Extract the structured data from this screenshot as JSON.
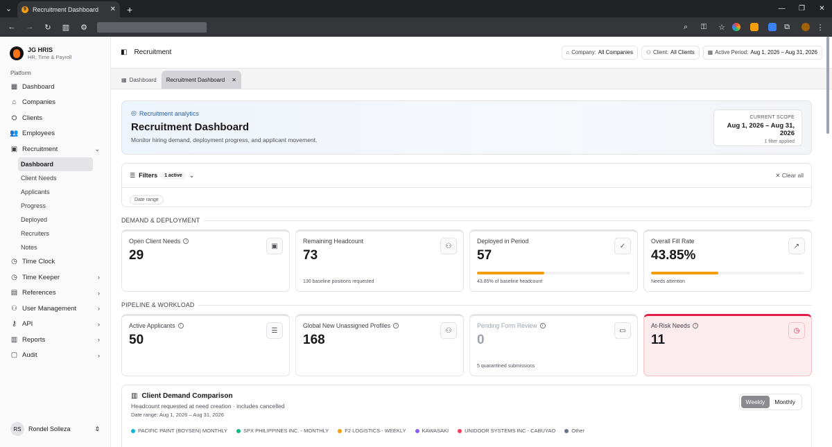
{
  "browser": {
    "tab_title": "Recruitment Dashboard"
  },
  "brand": {
    "name": "JG HRIS",
    "subtitle": "HR, Time & Payroll"
  },
  "sidebar": {
    "section": "Platform",
    "items": [
      {
        "label": "Dashboard",
        "icon": "grid-icon"
      },
      {
        "label": "Companies",
        "icon": "building-icon"
      },
      {
        "label": "Clients",
        "icon": "clients-icon"
      },
      {
        "label": "Employees",
        "icon": "users-icon"
      },
      {
        "label": "Recruitment",
        "icon": "briefcase-icon"
      }
    ],
    "sub": [
      "Dashboard",
      "Client Needs",
      "Applicants",
      "Progress",
      "Deployed",
      "Recruiters",
      "Notes"
    ],
    "items2": [
      {
        "label": "Time Clock"
      },
      {
        "label": "Time Keeper"
      },
      {
        "label": "References"
      },
      {
        "label": "User Management"
      },
      {
        "label": "API"
      },
      {
        "label": "Reports"
      },
      {
        "label": "Audit"
      }
    ],
    "user": {
      "initials": "RS",
      "name": "Rondel Solleza"
    }
  },
  "topbar": {
    "title": "Recruitment",
    "company_label": "Company:",
    "company_value": "All Companies",
    "client_label": "Client:",
    "client_value": "All Clients",
    "period_label": "Active Period:",
    "period_value": "Aug 1, 2026 – Aug 31, 2026"
  },
  "tabs": {
    "dashboard": "Dashboard",
    "active": "Recruitment Dashboard"
  },
  "hero": {
    "tag": "Recruitment analytics",
    "title": "Recruitment Dashboard",
    "desc": "Monitor hiring demand, deployment progress, and applicant movement.",
    "scope_label": "CURRENT SCOPE",
    "scope_value": "Aug 1, 2026 – Aug 31, 2026",
    "scope_filter": "1 filter applied"
  },
  "filters": {
    "label": "Filters",
    "badge": "1 active",
    "clear": "Clear all",
    "pill": "Date range"
  },
  "sections": {
    "demand": "DEMAND & DEPLOYMENT",
    "pipeline": "PIPELINE & WORKLOAD"
  },
  "cards1": [
    {
      "label": "Open Client Needs",
      "value": "29"
    },
    {
      "label": "Remaining Headcount",
      "value": "73",
      "note": "130 baseline positions requested"
    },
    {
      "label": "Deployed in Period",
      "value": "57",
      "note": "43.85% of baseline headcount",
      "progress": 0.4385
    },
    {
      "label": "Overall Fill Rate",
      "value": "43.85%",
      "note": "Needs attention",
      "progress": 0.4385
    }
  ],
  "cards2": [
    {
      "label": "Active Applicants",
      "value": "50"
    },
    {
      "label": "Global New Unassigned Profiles",
      "value": "168"
    },
    {
      "label": "Pending Form Review",
      "value": "0",
      "note": "5 quarantined submissions"
    },
    {
      "label": "At-Risk Needs",
      "value": "11"
    }
  ],
  "demand_chart": {
    "title": "Client Demand Comparison",
    "subtitle": "Headcount requested at need creation · includes cancelled",
    "range": "Date range: Aug 1, 2026 – Aug 31, 2026",
    "weekly": "Weekly",
    "monthly": "Monthly",
    "legend": [
      {
        "name": "PACIFIC PAINT (BOYSEN) MONTHLY",
        "color": "#06b6d4"
      },
      {
        "name": "SPX PHILIPPINES INC. - MONTHLY",
        "color": "#10b981"
      },
      {
        "name": "F2 LOGISTICS - WEEKLY",
        "color": "#f59e0b"
      },
      {
        "name": "KAWASAKI",
        "color": "#8b5cf6"
      },
      {
        "name": "UNIDOOR SYSTEMS INC - CABUYAO",
        "color": "#f43f5e"
      },
      {
        "name": "Other",
        "color": "#64748b"
      }
    ]
  }
}
